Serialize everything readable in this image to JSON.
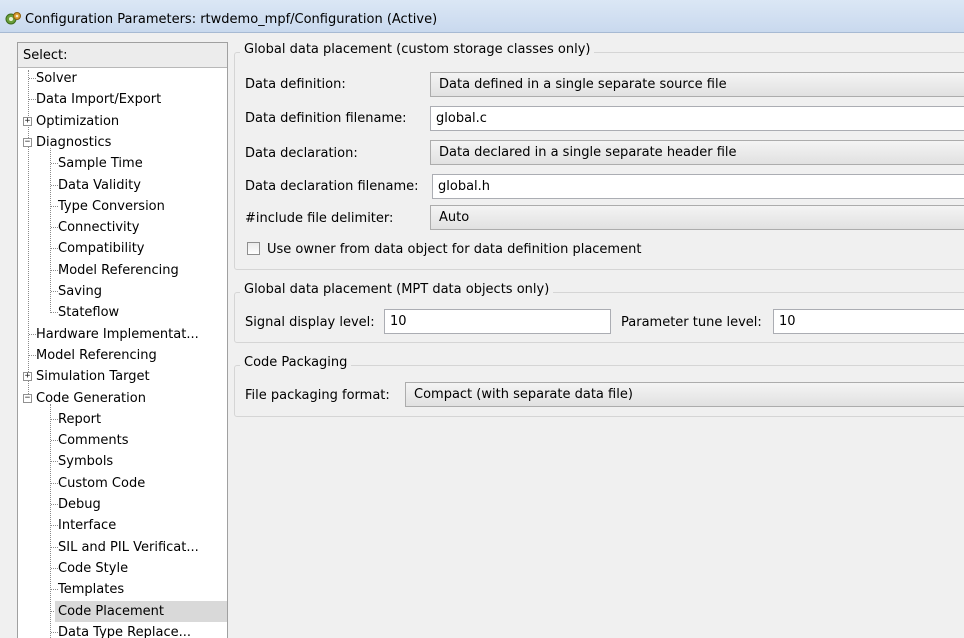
{
  "window": {
    "title": "Configuration Parameters: rtwdemo_mpf/Configuration (Active)"
  },
  "left_panel": {
    "header": "Select:",
    "items": [
      {
        "label": "Solver"
      },
      {
        "label": "Data Import/Export"
      },
      {
        "label": "Optimization",
        "expand": "+"
      },
      {
        "label": "Diagnostics",
        "expand": "−"
      },
      {
        "label": "Sample Time"
      },
      {
        "label": "Data Validity"
      },
      {
        "label": "Type Conversion"
      },
      {
        "label": "Connectivity"
      },
      {
        "label": "Compatibility"
      },
      {
        "label": "Model Referencing"
      },
      {
        "label": "Saving"
      },
      {
        "label": "Stateflow"
      },
      {
        "label": "Hardware Implementat..."
      },
      {
        "label": "Model Referencing"
      },
      {
        "label": "Simulation Target",
        "expand": "+"
      },
      {
        "label": "Code Generation",
        "expand": "−"
      },
      {
        "label": "Report"
      },
      {
        "label": "Comments"
      },
      {
        "label": "Symbols"
      },
      {
        "label": "Custom Code"
      },
      {
        "label": "Debug"
      },
      {
        "label": "Interface"
      },
      {
        "label": "SIL and PIL Verificat..."
      },
      {
        "label": "Code Style"
      },
      {
        "label": "Templates"
      },
      {
        "label": "Code Placement",
        "selected": true
      },
      {
        "label": "Data Type Replace..."
      }
    ]
  },
  "global_custom": {
    "legend": "Global data placement (custom storage classes only)",
    "data_definition": {
      "label": "Data definition:",
      "value": "Data defined in a single separate source file"
    },
    "data_definition_filename": {
      "label": "Data definition filename:",
      "value": "global.c"
    },
    "data_declaration": {
      "label": "Data declaration:",
      "value": "Data declared in a single separate header file"
    },
    "data_declaration_filename": {
      "label": "Data declaration filename:",
      "value": "global.h"
    },
    "include_delimiter": {
      "label": "#include file delimiter:",
      "value": "Auto"
    },
    "owner_checkbox": {
      "label": "Use owner from data object for data definition placement",
      "checked": false
    }
  },
  "global_mpt": {
    "legend": "Global data placement (MPT data objects only)",
    "signal_display": {
      "label": "Signal display level:",
      "value": "10"
    },
    "parameter_tune": {
      "label": "Parameter tune level:",
      "value": "10"
    }
  },
  "code_packaging": {
    "legend": "Code Packaging",
    "file_packaging": {
      "label": "File packaging format:",
      "value": "Compact (with separate data file)"
    }
  }
}
